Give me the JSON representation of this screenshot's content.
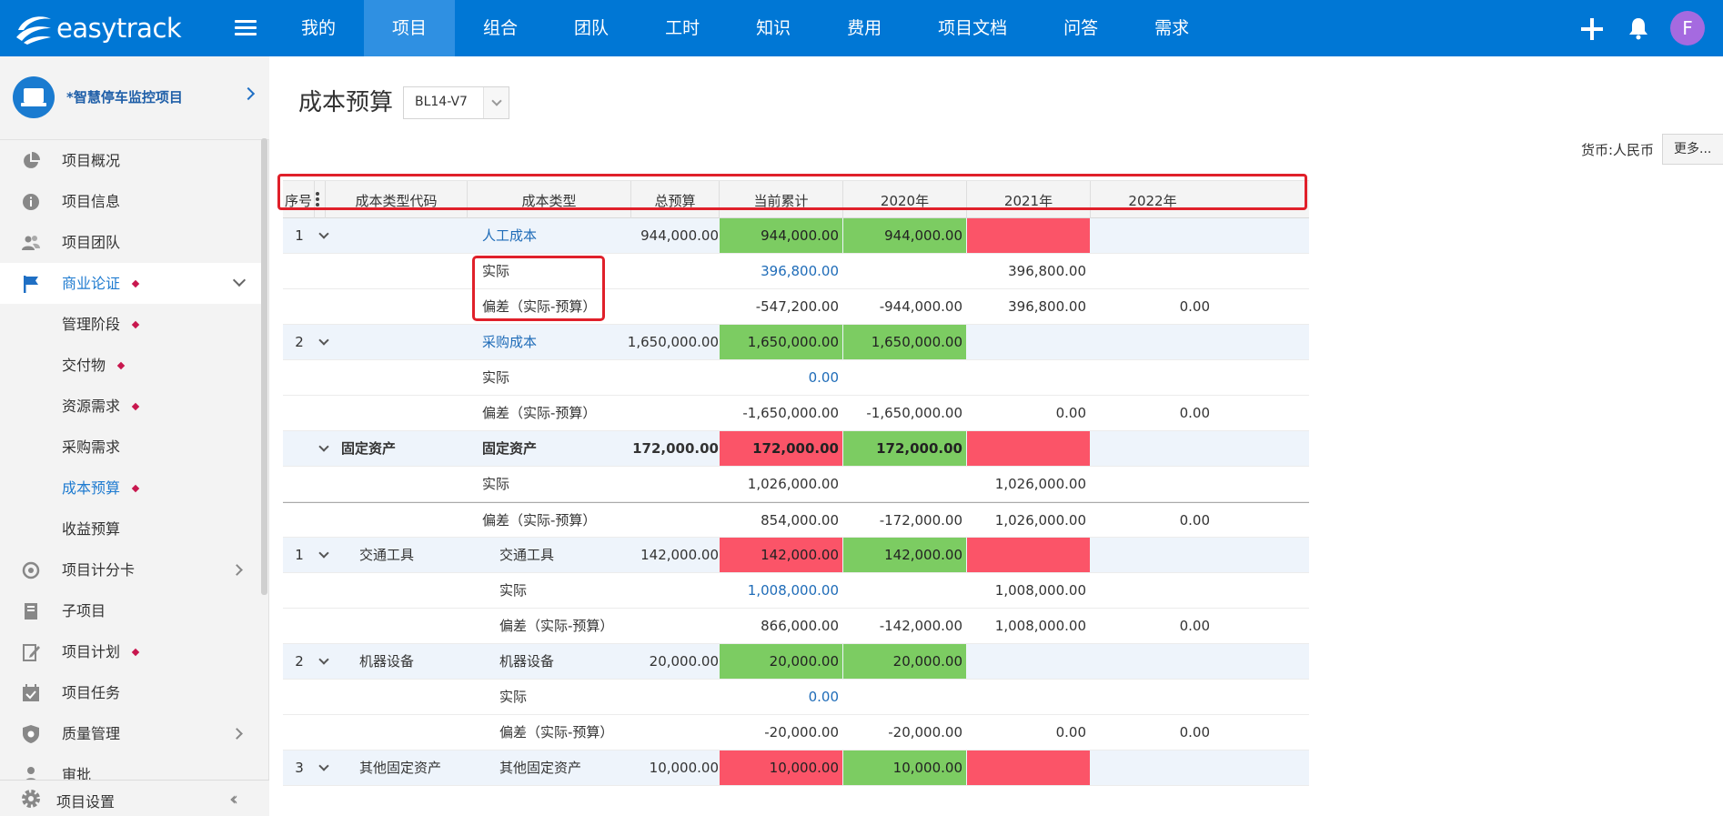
{
  "app": {
    "logo_text": "easytrack",
    "avatar_letter": "F"
  },
  "nav": {
    "items": [
      {
        "label": "我的"
      },
      {
        "label": "项目"
      },
      {
        "label": "组合"
      },
      {
        "label": "团队"
      },
      {
        "label": "工时"
      },
      {
        "label": "知识"
      },
      {
        "label": "费用"
      },
      {
        "label": "项目文档"
      },
      {
        "label": "问答"
      },
      {
        "label": "需求"
      }
    ],
    "active_index": 1
  },
  "sidebar": {
    "project_name": "*智慧停车监控项目",
    "items": [
      {
        "label": "项目概况",
        "icon": "pie-chart-icon"
      },
      {
        "label": "项目信息",
        "icon": "info-icon"
      },
      {
        "label": "项目团队",
        "icon": "team-icon"
      },
      {
        "label": "商业论证",
        "icon": "flag-icon"
      },
      {
        "label": "管理阶段"
      },
      {
        "label": "交付物"
      },
      {
        "label": "资源需求"
      },
      {
        "label": "采购需求"
      },
      {
        "label": "成本预算"
      },
      {
        "label": "收益预算"
      },
      {
        "label": "项目计分卡",
        "icon": "target-icon"
      },
      {
        "label": "子项目",
        "icon": "subproject-icon"
      },
      {
        "label": "项目计划",
        "icon": "plan-icon"
      },
      {
        "label": "项目任务",
        "icon": "task-icon"
      },
      {
        "label": "质量管理",
        "icon": "shield-icon"
      },
      {
        "label": "审批",
        "icon": "approval-icon"
      }
    ],
    "settings_label": "项目设置"
  },
  "main": {
    "title": "成本预算",
    "version": "BL14-V7",
    "currency": "货币:人民币",
    "more_label": "更多..."
  },
  "table": {
    "headers": [
      "序号",
      "成本类型代码",
      "成本类型",
      "总预算",
      "当前累计",
      "2020年",
      "2021年",
      "2022年"
    ],
    "rows": [
      {
        "seq": "1",
        "code": "",
        "type": "人工成本",
        "total": "944,000.00",
        "cur": "944,000.00",
        "y20": "944,000.00",
        "y21": "",
        "y22": ""
      },
      {
        "seq": "",
        "code": "",
        "type": "实际",
        "total": "",
        "cur": "396,800.00",
        "y20": "",
        "y21": "396,800.00",
        "y22": ""
      },
      {
        "seq": "",
        "code": "",
        "type": "偏差（实际-预算）",
        "total": "",
        "cur": "-547,200.00",
        "y20": "-944,000.00",
        "y21": "396,800.00",
        "y22": "0.00"
      },
      {
        "seq": "2",
        "code": "",
        "type": "采购成本",
        "total": "1,650,000.00",
        "cur": "1,650,000.00",
        "y20": "1,650,000.00",
        "y21": "",
        "y22": ""
      },
      {
        "seq": "",
        "code": "",
        "type": "实际",
        "total": "",
        "cur": "0.00",
        "y20": "",
        "y21": "",
        "y22": ""
      },
      {
        "seq": "",
        "code": "",
        "type": "偏差（实际-预算）",
        "total": "",
        "cur": "-1,650,000.00",
        "y20": "-1,650,000.00",
        "y21": "0.00",
        "y22": "0.00"
      },
      {
        "seq": "",
        "code": "固定资产",
        "type": "固定资产",
        "total": "172,000.00",
        "cur": "172,000.00",
        "y20": "172,000.00",
        "y21": "",
        "y22": ""
      },
      {
        "seq": "",
        "code": "",
        "type": "实际",
        "total": "",
        "cur": "1,026,000.00",
        "y20": "",
        "y21": "1,026,000.00",
        "y22": ""
      },
      {
        "seq": "",
        "code": "",
        "type": "偏差（实际-预算）",
        "total": "",
        "cur": "854,000.00",
        "y20": "-172,000.00",
        "y21": "1,026,000.00",
        "y22": "0.00"
      },
      {
        "seq": "1",
        "code": "交通工具",
        "type": "交通工具",
        "total": "142,000.00",
        "cur": "142,000.00",
        "y20": "142,000.00",
        "y21": "",
        "y22": ""
      },
      {
        "seq": "",
        "code": "",
        "type": "实际",
        "total": "",
        "cur": "1,008,000.00",
        "y20": "",
        "y21": "1,008,000.00",
        "y22": ""
      },
      {
        "seq": "",
        "code": "",
        "type": "偏差（实际-预算）",
        "total": "",
        "cur": "866,000.00",
        "y20": "-142,000.00",
        "y21": "1,008,000.00",
        "y22": "0.00"
      },
      {
        "seq": "2",
        "code": "机器设备",
        "type": "机器设备",
        "total": "20,000.00",
        "cur": "20,000.00",
        "y20": "20,000.00",
        "y21": "",
        "y22": ""
      },
      {
        "seq": "",
        "code": "",
        "type": "实际",
        "total": "",
        "cur": "0.00",
        "y20": "",
        "y21": "",
        "y22": ""
      },
      {
        "seq": "",
        "code": "",
        "type": "偏差（实际-预算）",
        "total": "",
        "cur": "-20,000.00",
        "y20": "-20,000.00",
        "y21": "0.00",
        "y22": "0.00"
      },
      {
        "seq": "3",
        "code": "其他固定资产",
        "type": "其他固定资产",
        "total": "10,000.00",
        "cur": "10,000.00",
        "y20": "10,000.00",
        "y21": "",
        "y22": ""
      }
    ]
  },
  "colors": {
    "nav_bg": "#0077d5",
    "nav_active": "#2f90e2",
    "green": "#7ccc62",
    "red": "#fb5468",
    "highlight": "#e0202a"
  }
}
